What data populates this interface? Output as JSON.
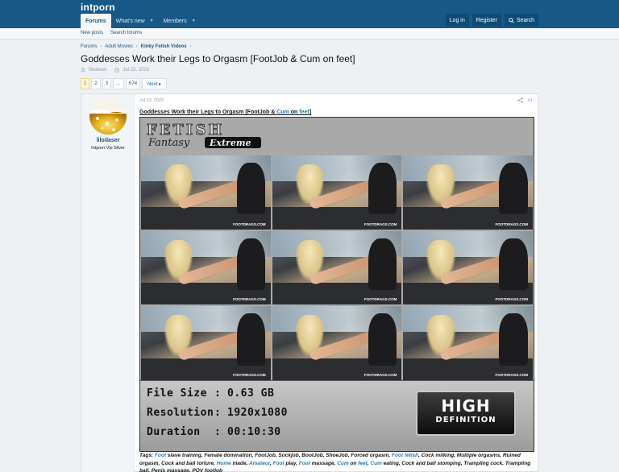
{
  "site": {
    "logo": "intporn"
  },
  "nav": {
    "forums": "Forums",
    "whats_new": "What's new",
    "members": "Members"
  },
  "header_right": {
    "login": "Log in",
    "register": "Register",
    "search": "Search"
  },
  "subnav": {
    "new_posts": "New posts",
    "search_forums": "Search forums"
  },
  "breadcrumb": [
    "Forums",
    "Adult Movies",
    "Kinky Fetish Videos"
  ],
  "thread": {
    "title": "Goddesses Work their Legs to Orgasm [FootJob & Cum on feet]",
    "author": "lilodaser",
    "date": "Jul 23, 2020"
  },
  "pager": {
    "pages": [
      "1",
      "2",
      "3",
      "…",
      "674"
    ],
    "current": "1",
    "next": "Next ▸"
  },
  "post": {
    "user": "lilodaser",
    "user_title": "Intporn Vip Silver",
    "date": "Jul 23, 2020",
    "number": "#1",
    "heading_pre": "Goddesses Work their Legs to Orgasm [FootJob & ",
    "heading_cum": "Cum",
    "heading_on": " on ",
    "heading_feet": "feet",
    "heading_post": "]"
  },
  "cover": {
    "logo_line1": "FETISH",
    "logo_line2": "Fantasy",
    "logo_line3": "Extreme",
    "watermark": "FOOTDRAGS.COM",
    "specs": [
      {
        "key": "File Size",
        "value": "0.63 GB"
      },
      {
        "key": "Resolution",
        "value": "1920x1080"
      },
      {
        "key": "Duration",
        "value": "00:10:30"
      }
    ],
    "hd_line1": "HIGH",
    "hd_line2": "DEFINITION"
  },
  "tags": {
    "label": "Tags:",
    "segments": [
      {
        "text": " ",
        "link": false
      },
      {
        "text": "Foot",
        "link": true
      },
      {
        "text": " slave training, Female domination, FootJob, Sockjob, BootJob, ShoeJob, Forced orgasm, ",
        "link": false
      },
      {
        "text": "Foot fetish",
        "link": true
      },
      {
        "text": ", Cock milking, Multiple orgasms, Ruined orgasm, Cock and ball torture, ",
        "link": false
      },
      {
        "text": "Home",
        "link": true
      },
      {
        "text": " made, ",
        "link": false
      },
      {
        "text": "Amateur",
        "link": true
      },
      {
        "text": ", ",
        "link": false
      },
      {
        "text": "Foot",
        "link": true
      },
      {
        "text": " play, ",
        "link": false
      },
      {
        "text": "Foot",
        "link": true
      },
      {
        "text": " massage, ",
        "link": false
      },
      {
        "text": "Cum",
        "link": true
      },
      {
        "text": " on ",
        "link": false
      },
      {
        "text": "feet",
        "link": true
      },
      {
        "text": ", ",
        "link": false
      },
      {
        "text": "Cum",
        "link": true
      },
      {
        "text": " eating, Cock and ball stomping, Trampling cock, Trampling ball, Penis massage, POV footjob",
        "link": false
      }
    ]
  },
  "colors": {
    "header": "#185886",
    "link": "#2577b1",
    "page_bg": "#eef1f4"
  }
}
